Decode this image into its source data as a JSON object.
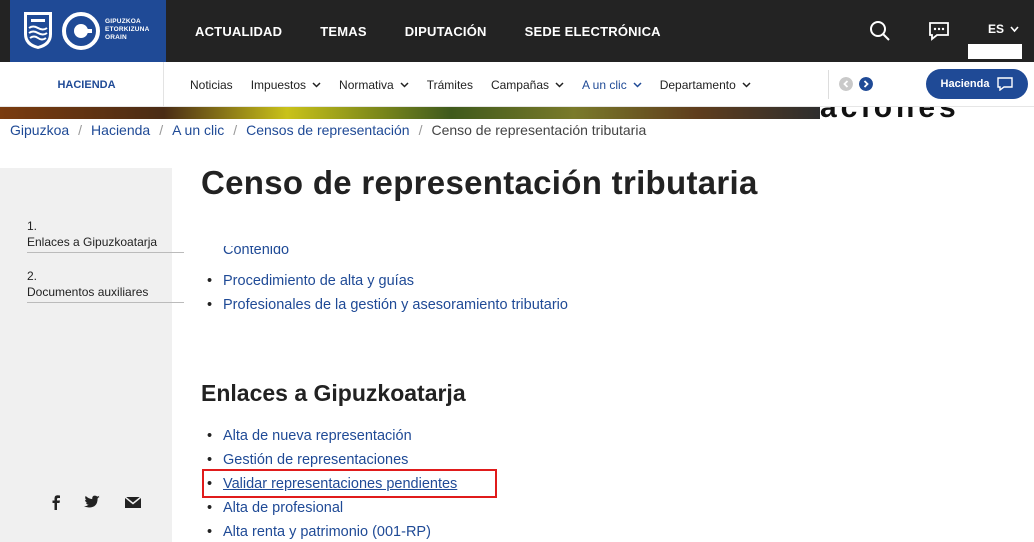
{
  "brand": {
    "line1": "GIPUZKOA",
    "line2": "ETORKIZUNA",
    "line3": "ORAIN"
  },
  "main_nav": [
    "ACTUALIDAD",
    "TEMAS",
    "DIPUTACIÓN",
    "SEDE ELECTRÓNICA"
  ],
  "header": {
    "lang": "ES",
    "search_icon": "search-icon",
    "chat_icon": "chat-icon"
  },
  "subnav": {
    "section": "HACIENDA",
    "items": [
      {
        "label": "Noticias",
        "dropdown": false
      },
      {
        "label": "Impuestos",
        "dropdown": true
      },
      {
        "label": "Normativa",
        "dropdown": true
      },
      {
        "label": "Trámites",
        "dropdown": false
      },
      {
        "label": "Campañas",
        "dropdown": true
      },
      {
        "label": "A un clic",
        "dropdown": true,
        "active": true
      },
      {
        "label": "Departamento",
        "dropdown": true
      }
    ],
    "button_label": "Hacienda"
  },
  "hero_text": "aciones",
  "breadcrumb": [
    "Gipuzkoa",
    "Hacienda",
    "A un clic",
    "Censos de representación",
    "Censo de representación tributaria"
  ],
  "sidebar": {
    "items": [
      {
        "num": "1.",
        "label": "Enlaces a Gipuzkoatarja"
      },
      {
        "num": "2.",
        "label": "Documentos auxiliares"
      }
    ],
    "social": [
      "facebook-icon",
      "twitter-icon",
      "mail-icon"
    ]
  },
  "main": {
    "title": "Censo de representación tributaria",
    "clipped_item": "Contenido",
    "intro_links": [
      "Procedimiento de alta y guías",
      "Profesionales de la gestión y asesoramiento tributario"
    ],
    "section_title": "Enlaces a Gipuzkoatarja",
    "section_links": [
      "Alta de nueva representación",
      "Gestión de representaciones",
      "Validar representaciones pendientes",
      "Alta de profesional",
      "Alta renta y patrimonio (001-RP)"
    ]
  },
  "colors": {
    "brand_blue": "#1f4a96",
    "topbar": "#232323",
    "highlight": "#e01b1b"
  }
}
